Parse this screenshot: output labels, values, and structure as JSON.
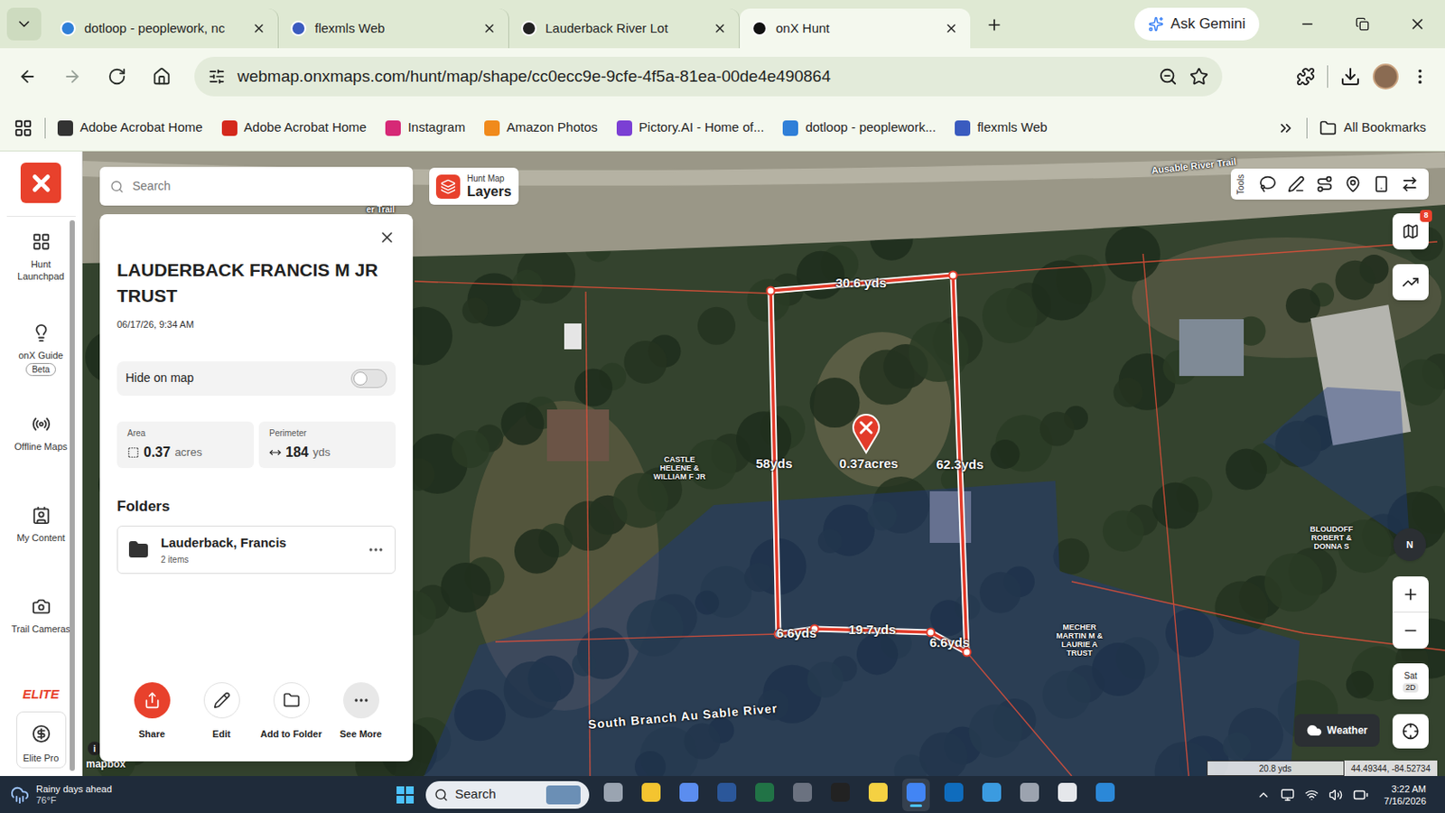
{
  "browser": {
    "tabs": [
      {
        "label": "dotloop - peoplework, nc",
        "selected": false,
        "color": "#2f7fd8"
      },
      {
        "label": "flexmls Web",
        "selected": false,
        "color": "#3a5bbf"
      },
      {
        "label": "Lauderback River Lot",
        "selected": false,
        "color": "#222222"
      },
      {
        "label": "onX Hunt",
        "selected": true,
        "color": "#111111"
      }
    ],
    "gemini": "Ask Gemini",
    "url": "webmap.onxmaps.com/hunt/map/shape/cc0ecc9e-9cfe-4f5a-81ea-00de4e490864",
    "bookmarks": [
      {
        "label": "Adobe Acrobat Home",
        "color": "#333333"
      },
      {
        "label": "Adobe Acrobat Home",
        "color": "#d4281c"
      },
      {
        "label": "Instagram",
        "color": "#d62976"
      },
      {
        "label": "Amazon Photos",
        "color": "#f08a1c"
      },
      {
        "label": "Pictory.AI - Home of...",
        "color": "#7b3fd4"
      },
      {
        "label": "dotloop - peoplework...",
        "color": "#2f7fd8"
      },
      {
        "label": "flexmls Web",
        "color": "#3a5bbf"
      }
    ],
    "all_bookmarks": "All Bookmarks"
  },
  "sidebar": {
    "items": [
      {
        "label": "Hunt Launchpad"
      },
      {
        "label": "onX Guide",
        "badge": "Beta"
      },
      {
        "label": "Offline Maps"
      },
      {
        "label": "My Content"
      },
      {
        "label": "Trail Cameras"
      }
    ],
    "tier": "ELITE",
    "tier_item": "Elite Pro"
  },
  "map": {
    "search": {
      "placeholder": "Search"
    },
    "layers": {
      "caption": "Hunt Map",
      "label": "Layers"
    },
    "tools_label": "Tools",
    "notification_badge": "8",
    "compass": "N",
    "map_type": {
      "top": "Sat",
      "bottom": "2D"
    },
    "weather": "Weather",
    "scale": "20.8 yds",
    "coordinates": "44.49344, -84.52734",
    "attribution": "mapbox",
    "info": "i",
    "roads": [
      "Ausable River Trail",
      "er Trail"
    ],
    "water": "South Branch Au Sable River",
    "owners": [
      "CASTLE HELENE & WILLIAM F JR",
      "BLOUDOFF ROBERT & DONNA S",
      "MECHER MARTIN M & LAURIE A TRUST"
    ],
    "shape": {
      "area_label": "0.37acres",
      "measurements": [
        "30.6 yds",
        "58yds",
        "62.3yds",
        "6.6yds",
        "19.7yds",
        "6.6yds"
      ]
    }
  },
  "panel": {
    "title": "LAUDERBACK FRANCIS M JR TRUST",
    "timestamp": "06/17/26, 9:34 AM",
    "hide_on_map": {
      "label": "Hide on map",
      "on": false
    },
    "stats": [
      {
        "label": "Area",
        "value": "0.37",
        "unit": "acres"
      },
      {
        "label": "Perimeter",
        "value": "184",
        "unit": "yds"
      }
    ],
    "folders_heading": "Folders",
    "folders": [
      {
        "name": "Lauderback, Francis",
        "count": "2 items"
      }
    ],
    "actions": [
      "Share",
      "Edit",
      "Add to Folder",
      "See More"
    ]
  },
  "taskbar": {
    "weather": {
      "title": "Rainy days ahead",
      "temp": "76°F"
    },
    "search": "Search",
    "apps": [
      {
        "color": "#9aa4b1",
        "selected": false
      },
      {
        "color": "#f4c430",
        "selected": false
      },
      {
        "color": "#5b8def",
        "selected": false
      },
      {
        "color": "#2b579a",
        "selected": false
      },
      {
        "color": "#217346",
        "selected": false
      },
      {
        "color": "#6b7280",
        "selected": false
      },
      {
        "color": "#222222",
        "selected": false
      },
      {
        "color": "#f5d142",
        "selected": false
      },
      {
        "color": "#4285f4",
        "selected": true
      },
      {
        "color": "#0f6cbd",
        "selected": false
      },
      {
        "color": "#3b9be0",
        "selected": false
      },
      {
        "color": "#9ca3af",
        "selected": false
      },
      {
        "color": "#e5e7eb",
        "selected": false
      },
      {
        "color": "#2b88d8",
        "selected": false
      }
    ],
    "time": "3:22 AM",
    "date": "7/16/2026"
  }
}
